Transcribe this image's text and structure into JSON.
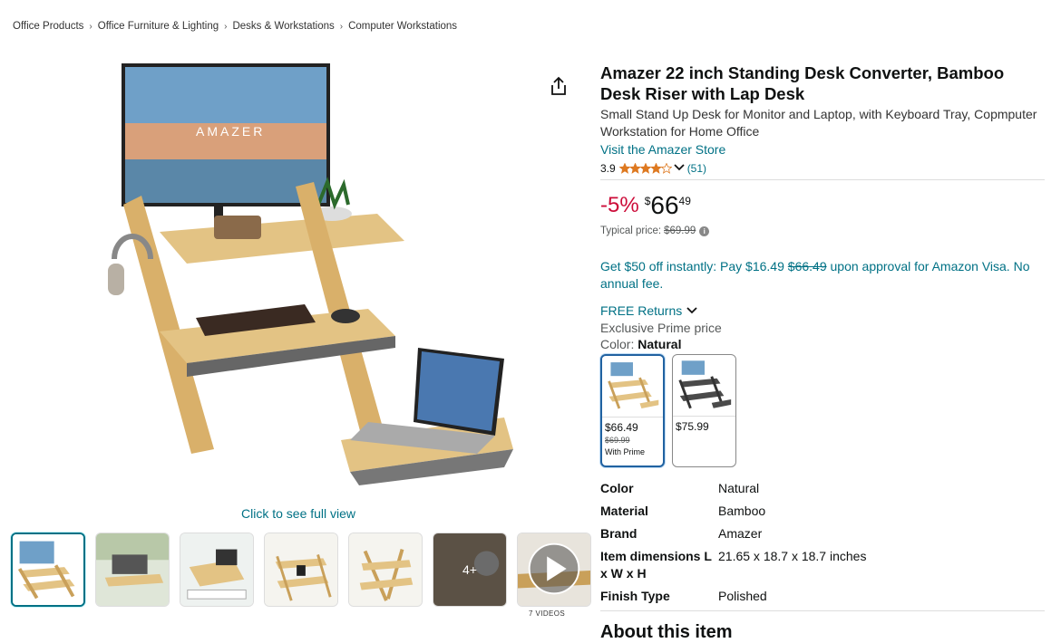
{
  "breadcrumb": [
    "Office Products",
    "Office Furniture & Lighting",
    "Desks & Workstations",
    "Computer Workstations"
  ],
  "gallery": {
    "click_full_view": "Click to see full view",
    "more_label": "4+",
    "videos_label": "7 VIDEOS",
    "main_image_brand_text": "AMAZER"
  },
  "product": {
    "title": "Amazer 22 inch Standing Desk Converter, Bamboo Desk Riser with Lap Desk",
    "subtitle": "Small Stand Up Desk for Monitor and Laptop, with Keyboard Tray, Copmputer Workstation for Home Office",
    "store_link": "Visit the Amazer Store",
    "rating": "3.9",
    "rating_count": "(51)",
    "stars_value": 3.9
  },
  "price": {
    "discount": "-5%",
    "currency": "$",
    "whole": "66",
    "fraction": "49",
    "typical_label": "Typical price:",
    "typical_value": "$69.99"
  },
  "offer": {
    "prefix": "Get $50 off instantly: Pay $16.49",
    "strike": "$66.49",
    "suffix": "upon approval for Amazon Visa. No annual fee."
  },
  "returns": "FREE Returns",
  "exclusive": "Exclusive Prime price",
  "color": {
    "label": "Color:",
    "selected": "Natural",
    "options": [
      {
        "price": "$66.49",
        "old": "$69.99",
        "note": "With Prime"
      },
      {
        "price": "$75.99",
        "old": "",
        "note": ""
      }
    ]
  },
  "specs": [
    {
      "k": "Color",
      "v": "Natural"
    },
    {
      "k": "Material",
      "v": "Bamboo"
    },
    {
      "k": "Brand",
      "v": "Amazer"
    },
    {
      "k": "Item dimensions L x W x H",
      "v": "21.65 x 18.7 x 18.7 inches"
    },
    {
      "k": "Finish Type",
      "v": "Polished"
    }
  ],
  "about_heading": "About this item",
  "colors": {
    "link": "#007185",
    "discount": "#cc0c39",
    "star": "#de7921",
    "selected_border": "#2162a1"
  }
}
